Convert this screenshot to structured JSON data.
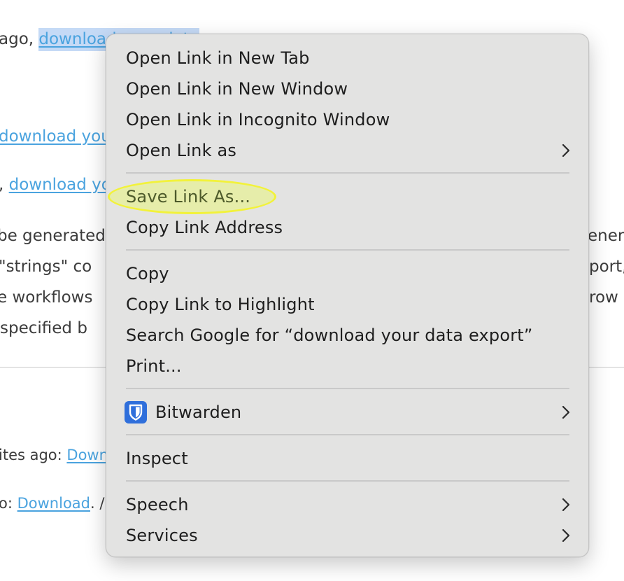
{
  "background": {
    "lines": [
      {
        "prefix": "ago, ",
        "link": "download your data"
      },
      {
        "prefix": "",
        "link": "download your"
      },
      {
        "prefix": ", ",
        "link": "download yo"
      },
      {
        "prefix": "be generated",
        "link": ""
      },
      {
        "prefix": "\"strings\" co",
        "link": ""
      },
      {
        "prefix": "e workflows",
        "link": ""
      },
      {
        "prefix": "specified b",
        "link": ""
      },
      {
        "prefix": "ites ago: ",
        "link": "Down"
      },
      {
        "prefix": "o: ",
        "link": "Download",
        "suffix": ". /"
      }
    ],
    "right_fragments": [
      "ener",
      "port,",
      "row"
    ]
  },
  "menu": {
    "items": [
      {
        "label": "Open Link in New Tab",
        "submenu": false
      },
      {
        "label": "Open Link in New Window",
        "submenu": false
      },
      {
        "label": "Open Link in Incognito Window",
        "submenu": false
      },
      {
        "label": "Open Link as",
        "submenu": true
      },
      {
        "label": "Save Link As...",
        "submenu": false,
        "highlighted": true
      },
      {
        "label": "Copy Link Address",
        "submenu": false
      },
      {
        "label": "Copy",
        "submenu": false
      },
      {
        "label": "Copy Link to Highlight",
        "submenu": false
      },
      {
        "label": "Search Google for “download your data export”",
        "submenu": false
      },
      {
        "label": "Print...",
        "submenu": false
      },
      {
        "label": "Bitwarden",
        "submenu": true,
        "icon": "bitwarden-shield-icon"
      },
      {
        "label": "Inspect",
        "submenu": false
      },
      {
        "label": "Speech",
        "submenu": true
      },
      {
        "label": "Services",
        "submenu": true
      }
    ],
    "highlight_color": "#f2f23a",
    "bitwarden_color": "#2f6fdb"
  }
}
